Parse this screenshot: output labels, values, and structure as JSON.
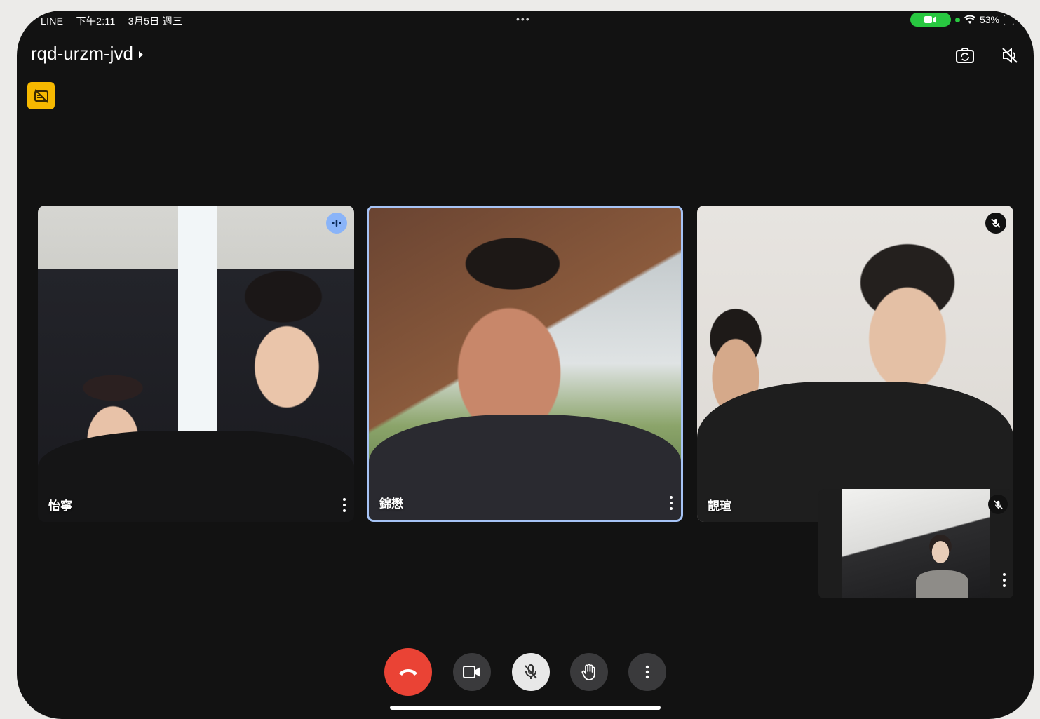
{
  "status_bar": {
    "carrier": "LINE",
    "time": "下午2:11",
    "date": "3月5日 週三",
    "more_dots": "•••",
    "battery": "53%"
  },
  "meeting": {
    "code": "rqd-urzm-jvd"
  },
  "participants": [
    {
      "name": "怡寧",
      "state": "speaking"
    },
    {
      "name": "錦懋",
      "state": "active"
    },
    {
      "name": "靚瑄",
      "state": "muted"
    }
  ],
  "self_view": {
    "state": "muted"
  },
  "colors": {
    "end_call": "#ea4335",
    "highlight_border": "#a6c3f5",
    "badge": "#f6b800",
    "speaking": "#8ab4f8"
  },
  "icons": {
    "switch_camera": "switch-camera-icon",
    "audio_off": "speaker-off-icon",
    "captions_off": "no-captions-icon"
  }
}
